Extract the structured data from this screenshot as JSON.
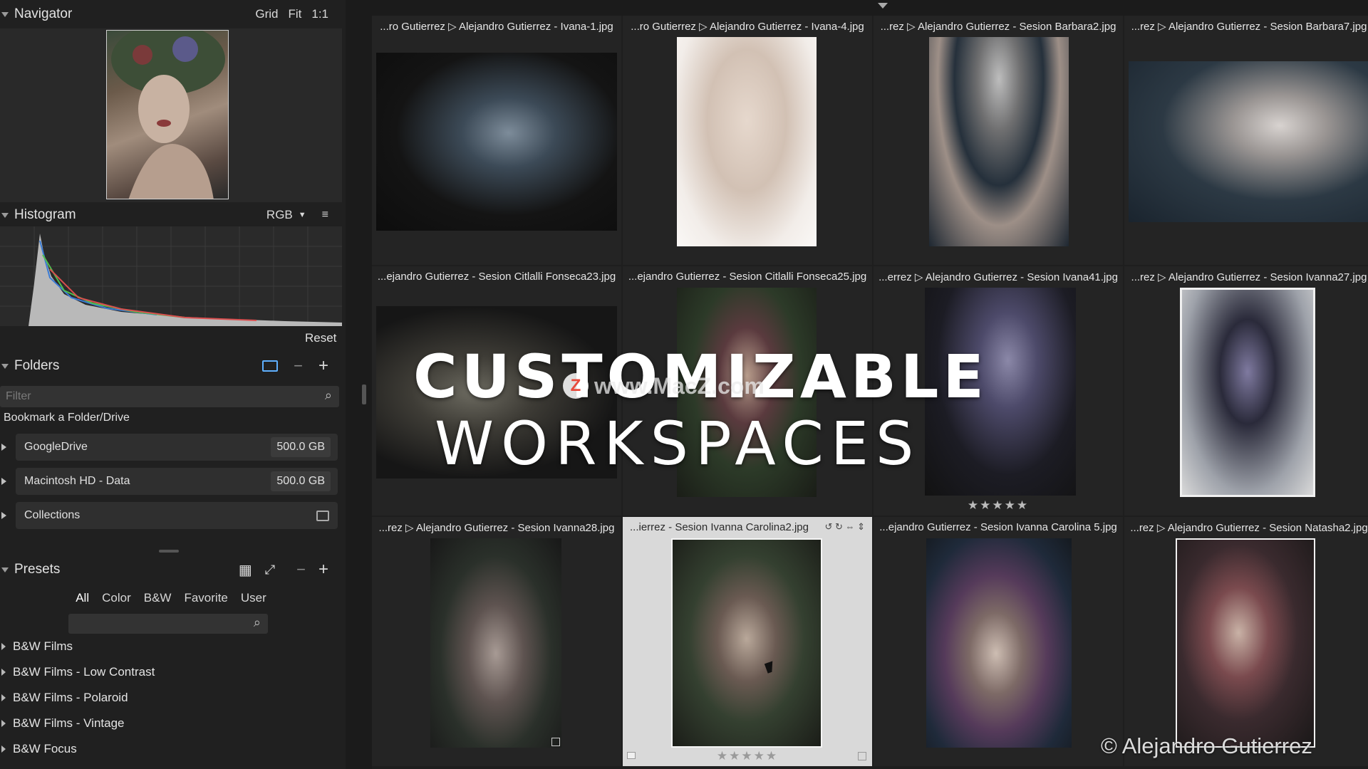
{
  "navigator": {
    "title": "Navigator",
    "grid": "Grid",
    "fit": "Fit",
    "one_to_one": "1:1"
  },
  "histogram": {
    "title": "Histogram",
    "mode": "RGB",
    "reset": "Reset"
  },
  "folders": {
    "title": "Folders",
    "filter_placeholder": "Filter",
    "bookmark": "Bookmark a Folder/Drive",
    "drives": [
      {
        "label": "GoogleDrive",
        "size": "500.0 GB"
      },
      {
        "label": "Macintosh HD - Data",
        "size": "500.0 GB"
      }
    ],
    "collections": "Collections"
  },
  "presets": {
    "title": "Presets",
    "tabs": [
      "All",
      "Color",
      "B&W",
      "Favorite",
      "User"
    ],
    "items": [
      "B&W Films",
      "B&W Films - Low Contrast",
      "B&W Films - Polaroid",
      "B&W Films - Vintage",
      "B&W Focus"
    ]
  },
  "grid": {
    "cells": [
      {
        "caption": "...ro Gutierrez ▷ Alejandro Gutierrez - Ivana-1.jpg"
      },
      {
        "caption": "...ro Gutierrez ▷ Alejandro Gutierrez - Ivana-4.jpg"
      },
      {
        "caption": "...rez ▷ Alejandro Gutierrez - Sesion Barbara2.jpg"
      },
      {
        "caption": "...rez ▷ Alejandro Gutierrez - Sesion Barbara7.jpg"
      },
      {
        "caption": "...ejandro Gutierrez - Sesion Citlalli Fonseca23.jpg"
      },
      {
        "caption": "...ejandro Gutierrez - Sesion Citlalli Fonseca25.jpg"
      },
      {
        "caption": "...errez ▷ Alejandro Gutierrez - Sesion Ivana41.jpg",
        "stars": "★★★★★"
      },
      {
        "caption": "...rez ▷ Alejandro Gutierrez - Sesion Ivanna27.jpg"
      },
      {
        "caption": "...rez ▷ Alejandro Gutierrez - Sesion Ivanna28.jpg"
      },
      {
        "caption": "...ierrez - Sesion Ivanna Carolina2.jpg",
        "stars": "★★★★★"
      },
      {
        "caption": "...ejandro Gutierrez - Sesion Ivanna Carolina 5.jpg"
      },
      {
        "caption": "...rez ▷ Alejandro Gutierrez - Sesion Natasha2.jpg"
      }
    ]
  },
  "overlay": {
    "line1": "CUSTOMIZABLE",
    "line2": "WORKSPACES",
    "watermark": "www.MacZ.com",
    "watermark_logo": "Z"
  },
  "copyright": "© Alejandro Gutierrez"
}
